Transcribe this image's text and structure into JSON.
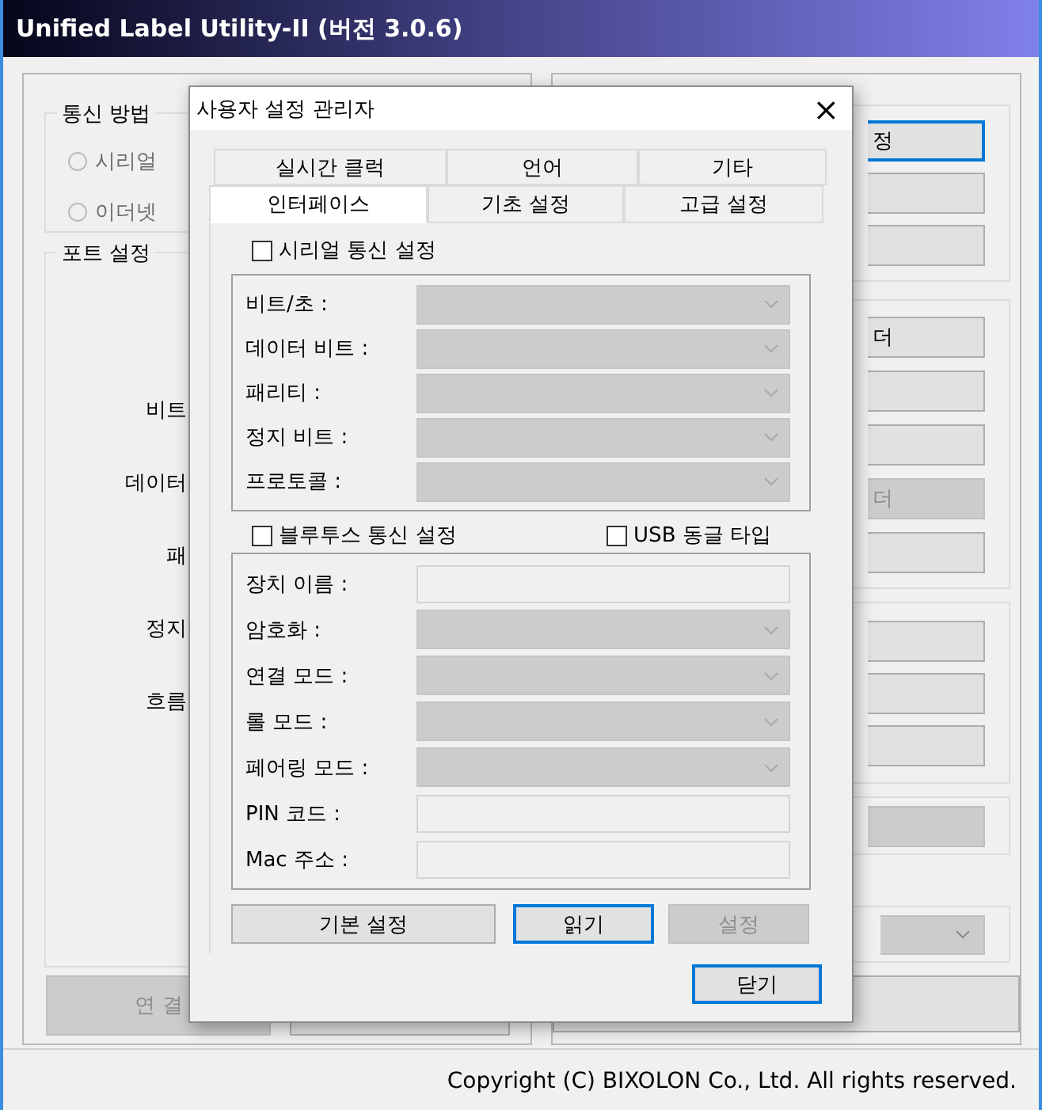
{
  "window": {
    "title": "Unified Label Utility-II (버전 3.0.6)"
  },
  "main": {
    "comm_method": {
      "label": "통신 방법",
      "options": [
        {
          "label": "시리얼",
          "selected": false,
          "disabled": true
        },
        {
          "label": "이더넷",
          "selected": false,
          "disabled": true
        }
      ]
    },
    "port_settings": {
      "label": "포트 설정",
      "fields": [
        "비트",
        "데이터",
        "패",
        "정지",
        "흐름"
      ]
    },
    "left_buttons": [
      {
        "label": "연 결",
        "disabled": true
      },
      {
        "disabled": false
      }
    ],
    "right_groups": [
      {
        "buttons": [
          {
            "label": "정",
            "focused": true,
            "disabled": false
          },
          {
            "focused": false,
            "disabled": false
          },
          {
            "focused": false,
            "disabled": false
          }
        ]
      },
      {
        "buttons": [
          {
            "label": "더",
            "focused": false,
            "disabled": false
          },
          {
            "focused": false,
            "disabled": false
          },
          {
            "focused": false,
            "disabled": false
          },
          {
            "label": "더",
            "focused": false,
            "disabled": true
          },
          {
            "focused": false,
            "disabled": false
          }
        ]
      },
      {
        "buttons": [
          {
            "focused": false,
            "disabled": false
          },
          {
            "focused": false,
            "disabled": false
          },
          {
            "focused": false,
            "disabled": false
          }
        ]
      },
      {
        "buttons": [
          {
            "focused": false,
            "disabled": true
          }
        ]
      },
      {
        "buttons": [
          {
            "kind": "combo",
            "disabled": true
          }
        ]
      }
    ],
    "right_bottom_button": {
      "disabled": false
    }
  },
  "dialog": {
    "title": "사용자 설정 관리자",
    "close": "×",
    "tab_rows": [
      [
        {
          "label": "실시간 클럭",
          "selected": false
        },
        {
          "label": "언어",
          "selected": false
        },
        {
          "label": "기타",
          "selected": false
        }
      ],
      [
        {
          "label": "인터페이스",
          "selected": true
        },
        {
          "label": "기초 설정",
          "selected": false
        },
        {
          "label": "고급 설정",
          "selected": false
        }
      ]
    ],
    "serial": {
      "label": "시리얼 통신 설정",
      "checked": false,
      "fields": [
        {
          "label": "비트/초 :",
          "kind": "combo"
        },
        {
          "label": "데이터 비트 :",
          "kind": "combo"
        },
        {
          "label": "패리티 :",
          "kind": "combo"
        },
        {
          "label": "정지 비트 :",
          "kind": "combo"
        },
        {
          "label": "프로토콜 :",
          "kind": "combo"
        }
      ]
    },
    "bluetooth": {
      "label": "블루투스 통신 설정",
      "checked": false
    },
    "usb_dongle": {
      "label": "USB 동글 타입",
      "checked": false
    },
    "bluetooth_fields": [
      {
        "label": "장치 이름 :",
        "kind": "text"
      },
      {
        "label": "암호화 :",
        "kind": "combo"
      },
      {
        "label": "연결 모드 :",
        "kind": "combo"
      },
      {
        "label": "롤 모드 :",
        "kind": "combo"
      },
      {
        "label": "페어링 모드 :",
        "kind": "combo"
      },
      {
        "label": "PIN 코드 :",
        "kind": "text"
      },
      {
        "label": "Mac 주소 :",
        "kind": "text"
      }
    ],
    "buttons": [
      {
        "label": "기본 설정",
        "focused": false,
        "disabled": false
      },
      {
        "label": "읽기",
        "focused": true,
        "disabled": false
      },
      {
        "label": "설정",
        "focused": false,
        "disabled": true
      }
    ],
    "close_button": {
      "label": "닫기",
      "focused": true
    }
  },
  "status_bar": {
    "copyright": "Copyright (C) BIXOLON Co., Ltd. All rights reserved."
  }
}
